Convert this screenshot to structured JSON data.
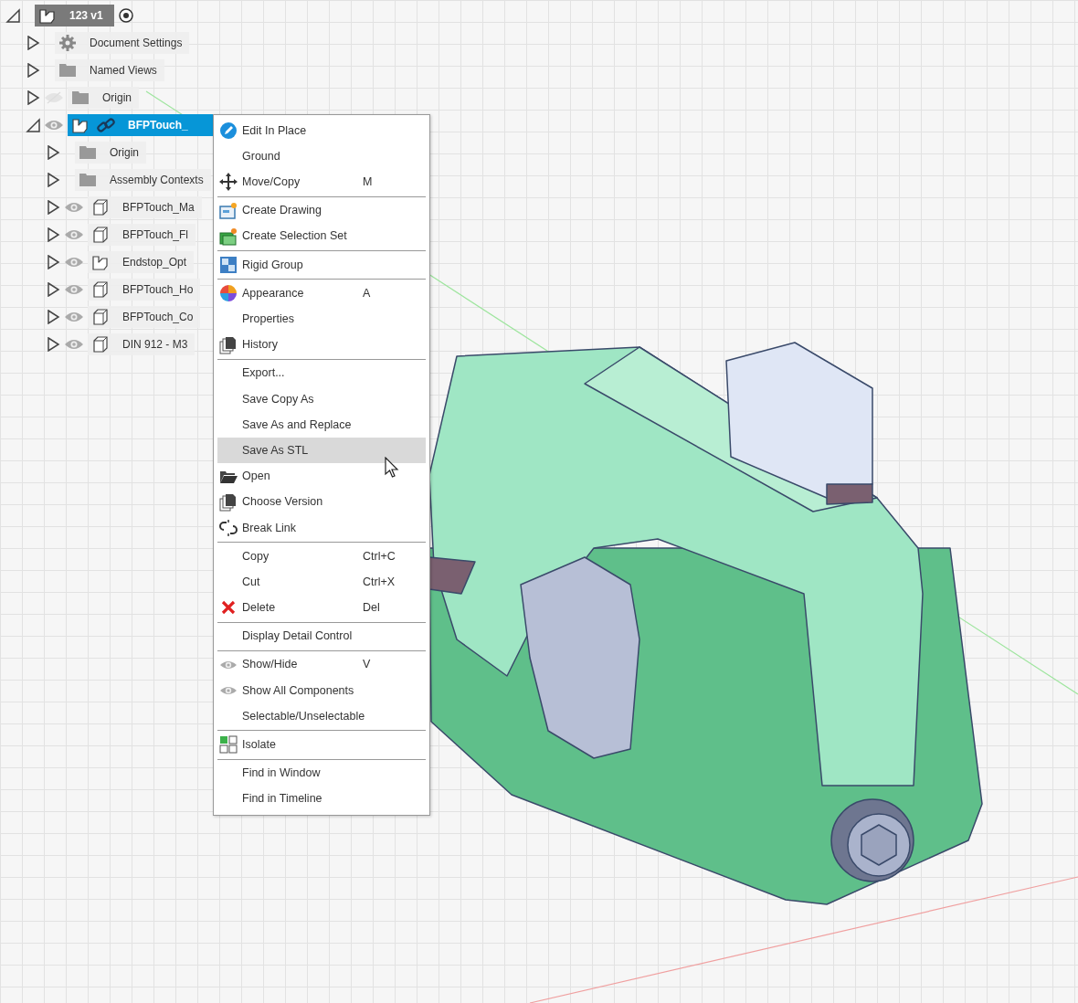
{
  "browser": {
    "root": {
      "label": "123 v1",
      "kind": "document",
      "expanded": true,
      "active": true,
      "children": [
        {
          "label": "Document Settings",
          "kind": "settings",
          "expanded": false,
          "selected": false
        },
        {
          "label": "Named Views",
          "kind": "folder",
          "expanded": false,
          "selected": false
        },
        {
          "label": "Origin",
          "kind": "folder",
          "expanded": false,
          "selected": false,
          "visible": false
        },
        {
          "label": "BFPTouch_",
          "kind": "component",
          "linked": true,
          "expanded": true,
          "selected": true,
          "visible": true,
          "children": [
            {
              "label": "Origin",
              "kind": "folder",
              "expanded": false,
              "selected": false
            },
            {
              "label": "Assembly Contexts",
              "kind": "folder",
              "expanded": false,
              "selected": false
            },
            {
              "label": "BFPTouch_Ma",
              "kind": "body",
              "expanded": false,
              "selected": false,
              "visible": true
            },
            {
              "label": "BFPTouch_Fl",
              "kind": "body",
              "expanded": false,
              "selected": false,
              "visible": true
            },
            {
              "label": "Endstop_Opt",
              "kind": "component",
              "expanded": false,
              "selected": false,
              "visible": true
            },
            {
              "label": "BFPTouch_Ho",
              "kind": "body",
              "expanded": false,
              "selected": false,
              "visible": true
            },
            {
              "label": "BFPTouch_Co",
              "kind": "body",
              "expanded": false,
              "selected": false,
              "visible": true
            },
            {
              "label": "DIN 912 - M3",
              "kind": "body",
              "expanded": false,
              "selected": false,
              "visible": true
            }
          ]
        }
      ]
    }
  },
  "context_menu": {
    "groups": [
      [
        {
          "label": "Edit In Place",
          "kind": "edit",
          "highlighted": false
        },
        {
          "label": "Ground",
          "highlighted": false
        },
        {
          "label": "Move/Copy",
          "shortcut": "M",
          "kind": "move",
          "highlighted": false
        }
      ],
      [
        {
          "label": "Create Drawing",
          "kind": "drawing",
          "highlighted": false
        },
        {
          "label": "Create Selection Set",
          "kind": "selection",
          "highlighted": false
        }
      ],
      [
        {
          "label": "Rigid Group",
          "kind": "rigid",
          "highlighted": false
        }
      ],
      [
        {
          "label": "Appearance",
          "shortcut": "A",
          "kind": "appearance",
          "highlighted": false
        },
        {
          "label": "Properties",
          "highlighted": false
        },
        {
          "label": "History",
          "kind": "pages",
          "highlighted": false
        }
      ],
      [
        {
          "label": "Export...",
          "highlighted": false
        },
        {
          "label": "Save Copy As",
          "highlighted": false
        },
        {
          "label": "Save As and Replace",
          "highlighted": false
        },
        {
          "label": "Save As STL",
          "highlighted": true
        },
        {
          "label": "Open",
          "kind": "open",
          "highlighted": false
        },
        {
          "label": "Choose Version",
          "kind": "pages",
          "highlighted": false
        },
        {
          "label": "Break Link",
          "kind": "breaklink",
          "highlighted": false
        }
      ],
      [
        {
          "label": "Copy",
          "shortcut": "Ctrl+C",
          "highlighted": false
        },
        {
          "label": "Cut",
          "shortcut": "Ctrl+X",
          "highlighted": false
        },
        {
          "label": "Delete",
          "shortcut": "Del",
          "kind": "delete",
          "highlighted": false
        }
      ],
      [
        {
          "label": "Display Detail Control",
          "highlighted": false
        }
      ],
      [
        {
          "label": "Show/Hide",
          "shortcut": "V",
          "kind": "eye",
          "highlighted": false
        },
        {
          "label": "Show All Components",
          "kind": "eye",
          "highlighted": false
        },
        {
          "label": "Selectable/Unselectable",
          "highlighted": false
        }
      ],
      [
        {
          "label": "Isolate",
          "kind": "isolate",
          "highlighted": false
        }
      ],
      [
        {
          "label": "Find in Window",
          "highlighted": false
        },
        {
          "label": "Find in Timeline",
          "highlighted": false
        }
      ]
    ]
  }
}
